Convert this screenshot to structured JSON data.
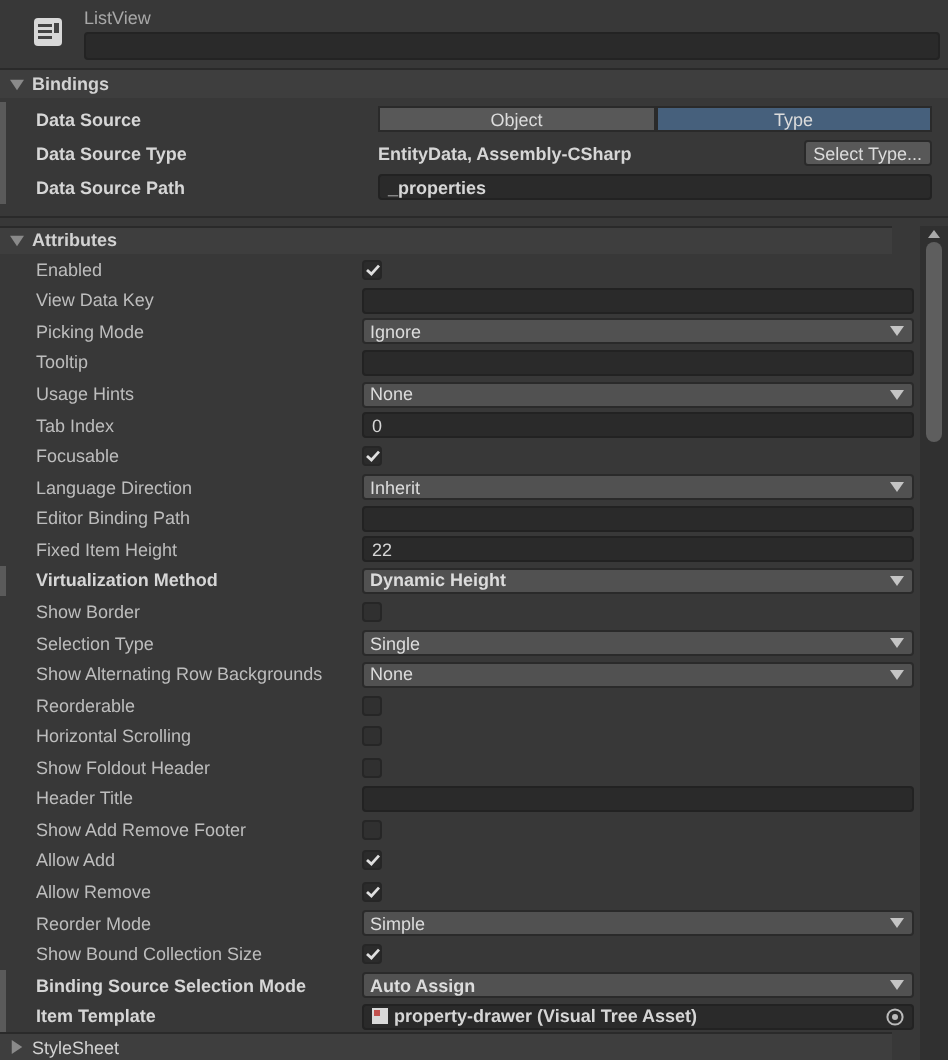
{
  "header": {
    "type_label": "ListView"
  },
  "bindings": {
    "title": "Bindings",
    "expanded": true,
    "data_source": {
      "label": "Data Source",
      "overridden": true,
      "options": [
        {
          "label": "Object",
          "selected": false
        },
        {
          "label": "Type",
          "selected": true
        }
      ]
    },
    "data_source_type": {
      "label": "Data Source Type",
      "overridden": true,
      "value": "EntityData, Assembly-CSharp",
      "button": "Select Type..."
    },
    "data_source_path": {
      "label": "Data Source Path",
      "overridden": true,
      "value": "_properties"
    }
  },
  "attributes": {
    "title": "Attributes",
    "expanded": true,
    "rows": [
      {
        "kind": "check",
        "label": "Enabled",
        "overridden": false,
        "checked": true
      },
      {
        "kind": "text",
        "label": "View Data Key",
        "overridden": false,
        "value": ""
      },
      {
        "kind": "dropdown",
        "label": "Picking Mode",
        "overridden": false,
        "value": "Ignore"
      },
      {
        "kind": "text",
        "label": "Tooltip",
        "overridden": false,
        "value": ""
      },
      {
        "kind": "dropdown",
        "label": "Usage Hints",
        "overridden": false,
        "value": "None"
      },
      {
        "kind": "text",
        "label": "Tab Index",
        "overridden": false,
        "value": "0"
      },
      {
        "kind": "check",
        "label": "Focusable",
        "overridden": false,
        "checked": true
      },
      {
        "kind": "dropdown",
        "label": "Language Direction",
        "overridden": false,
        "value": "Inherit"
      },
      {
        "kind": "text",
        "label": "Editor Binding Path",
        "overridden": false,
        "value": ""
      },
      {
        "kind": "text",
        "label": "Fixed Item Height",
        "overridden": false,
        "value": "22"
      },
      {
        "kind": "dropdown",
        "label": "Virtualization Method",
        "overridden": true,
        "value": "Dynamic Height"
      },
      {
        "kind": "check",
        "label": "Show Border",
        "overridden": false,
        "checked": false
      },
      {
        "kind": "dropdown",
        "label": "Selection Type",
        "overridden": false,
        "value": "Single"
      },
      {
        "kind": "dropdown",
        "label": "Show Alternating Row Backgrounds",
        "overridden": false,
        "value": "None"
      },
      {
        "kind": "check",
        "label": "Reorderable",
        "overridden": false,
        "checked": false
      },
      {
        "kind": "check",
        "label": "Horizontal Scrolling",
        "overridden": false,
        "checked": false
      },
      {
        "kind": "check",
        "label": "Show Foldout Header",
        "overridden": false,
        "checked": false
      },
      {
        "kind": "text",
        "label": "Header Title",
        "overridden": false,
        "value": ""
      },
      {
        "kind": "check",
        "label": "Show Add Remove Footer",
        "overridden": false,
        "checked": false
      },
      {
        "kind": "check",
        "label": "Allow Add",
        "overridden": false,
        "checked": true
      },
      {
        "kind": "check",
        "label": "Allow Remove",
        "overridden": false,
        "checked": true
      },
      {
        "kind": "dropdown",
        "label": "Reorder Mode",
        "overridden": false,
        "value": "Simple"
      },
      {
        "kind": "check",
        "label": "Show Bound Collection Size",
        "overridden": false,
        "checked": true
      },
      {
        "kind": "dropdown",
        "label": "Binding Source Selection Mode",
        "overridden": true,
        "value": "Auto Assign"
      },
      {
        "kind": "object",
        "label": "Item Template",
        "overridden": true,
        "value": "property-drawer (Visual Tree Asset)"
      }
    ]
  },
  "stylesheet": {
    "title": "StyleSheet",
    "expanded": false
  }
}
